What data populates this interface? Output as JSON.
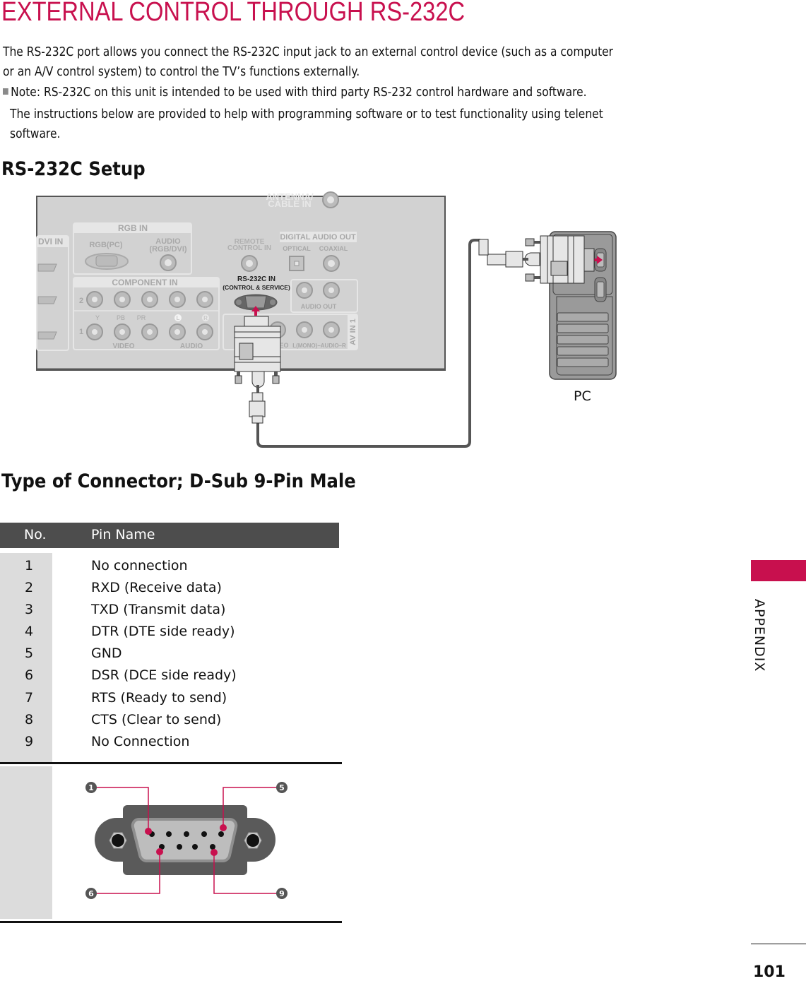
{
  "page": {
    "title": "EXTERNAL CONTROL THROUGH RS-232C",
    "intro_line1": "The RS-232C port allows you connect the RS-232C input jack to an external control device (such as a computer",
    "intro_line2": "or an A/V control system) to control the TV’s functions externally.",
    "note": "Note: RS-232C on this unit is intended to be used with third party RS-232 control hardware and software.",
    "instructions_line1": "The instructions below are provided to help with programming software or to test functionality using telenet",
    "instructions_line2": "software.",
    "accent_color": "#c8104e"
  },
  "setup": {
    "heading": "RS-232C Setup",
    "pc_label": "PC",
    "tv_panel": {
      "antenna_label_1": "ANTENNA/",
      "antenna_label_2": "CABLE IN",
      "dvi_in": "DVI IN",
      "rgb_in": "RGB IN",
      "rgb_pc": "RGB(PC)",
      "audio_rgb_dvi_1": "AUDIO",
      "audio_rgb_dvi_2": "(RGB/DVI)",
      "remote_1": "REMOTE",
      "remote_2": "CONTROL IN",
      "digital_audio_out": "DIGITAL AUDIO OUT",
      "optical": "OPTICAL",
      "coaxial": "COAXIAL",
      "component_in": "COMPONENT IN",
      "comp_row2": "2",
      "comp_row1": "1",
      "y": "Y",
      "pb": "PB",
      "pr": "PR",
      "l": "L",
      "r": "R",
      "video": "VIDEO",
      "audio": "AUDIO",
      "rs232_1": "RS-232C IN",
      "rs232_2": "(CONTROL & SERVICE)",
      "audio_out": "AUDIO OUT",
      "av_in_1": "AV IN 1",
      "av_audio": "L(MONO)–AUDIO–R",
      "av_video": "EO"
    }
  },
  "connector": {
    "heading": "Type of Connector; D-Sub 9-Pin Male",
    "table_headers": {
      "no": "No.",
      "pin_name": "Pin Name"
    },
    "pins": [
      {
        "no": "1",
        "name": "No connection"
      },
      {
        "no": "2",
        "name": "RXD (Receive data)"
      },
      {
        "no": "3",
        "name": "TXD (Transmit data)"
      },
      {
        "no": "4",
        "name": "DTR (DTE side ready)"
      },
      {
        "no": "5",
        "name": "GND"
      },
      {
        "no": "6",
        "name": "DSR (DCE side ready)"
      },
      {
        "no": "7",
        "name": "RTS (Ready to send)"
      },
      {
        "no": "8",
        "name": "CTS (Clear to send)"
      },
      {
        "no": "9",
        "name": "No Connection"
      }
    ],
    "callouts": [
      "1",
      "5",
      "6",
      "9"
    ]
  },
  "sidebar": {
    "section": "APPENDIX"
  },
  "footer": {
    "page_number": "101"
  }
}
